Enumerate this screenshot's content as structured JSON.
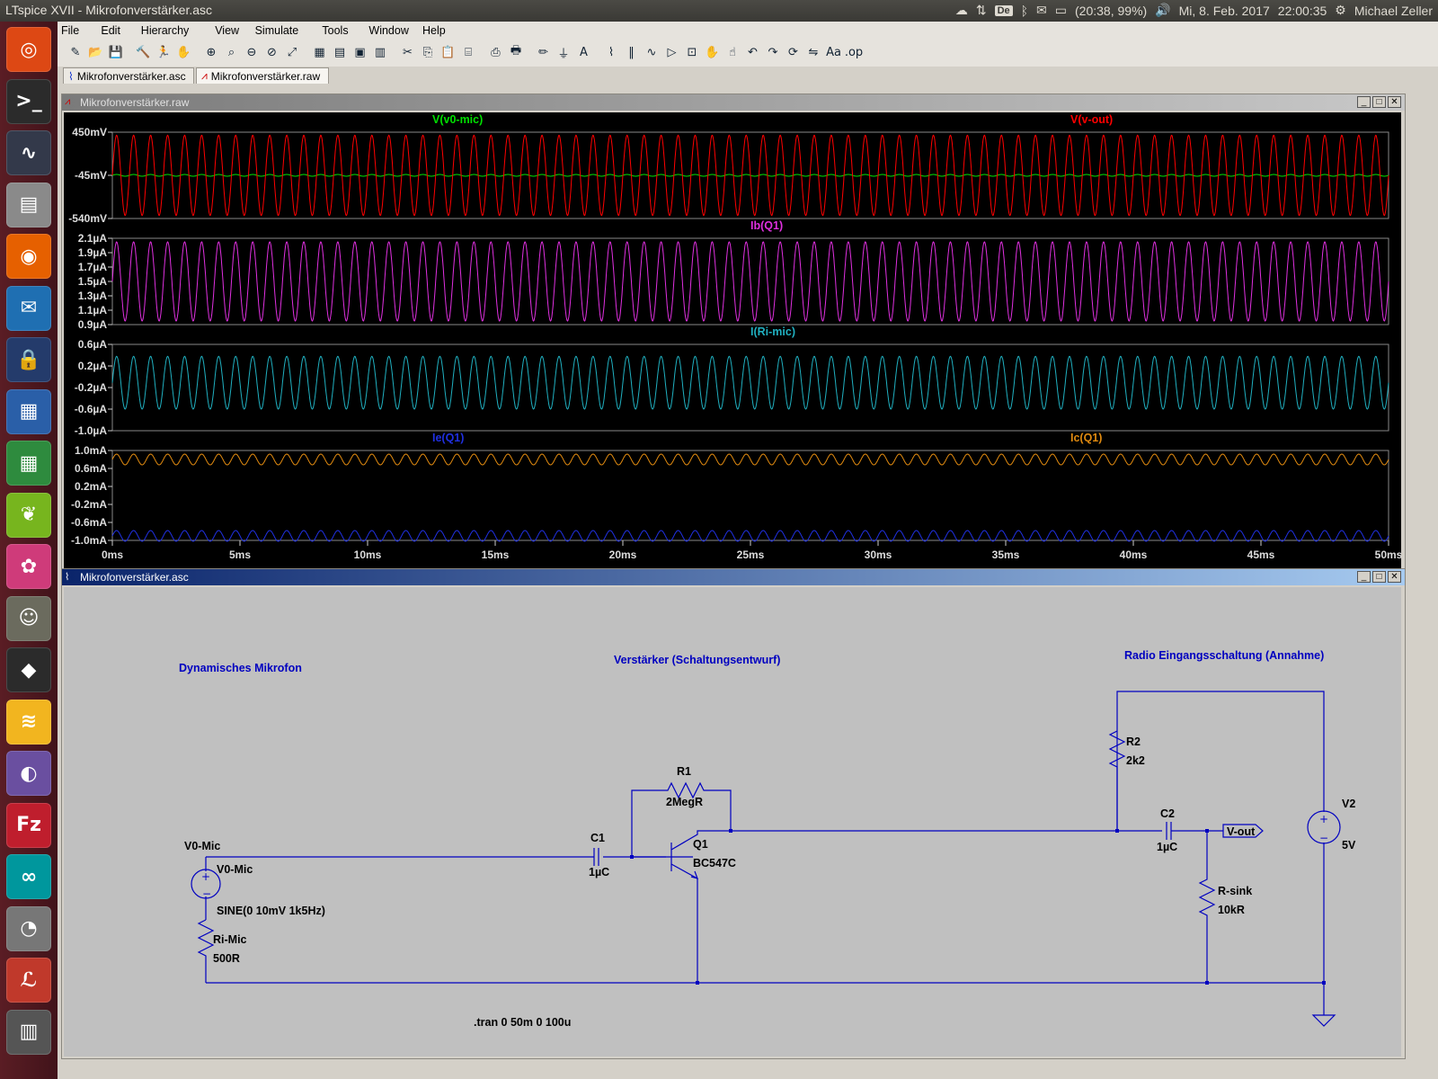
{
  "window_title": "LTspice XVII - Mikrofonverstärker.asc",
  "tray": {
    "keyboard": "De",
    "battery": "(20:38, 99%)",
    "date": "Mi, 8. Feb. 2017",
    "time": "22:00:35",
    "user": "Michael Zeller"
  },
  "launcher": [
    "ubuntu-icon",
    "terminal-icon",
    "system-monitor-icon",
    "file-manager-icon",
    "firefox-icon",
    "thunderbird-icon",
    "keepass-icon",
    "writer-icon",
    "calc-icon",
    "evolution-icon",
    "shotwell-icon",
    "gimp-icon",
    "inkscape-icon",
    "layers-icon",
    "eclipse-icon",
    "filezilla-icon",
    "arduino-icon",
    "disks-icon",
    "lazarus-icon",
    "stack-icon"
  ],
  "menu": [
    "File",
    "Edit",
    "Hierarchy",
    "View",
    "Simulate",
    "Tools",
    "Window",
    "Help"
  ],
  "tabs": [
    {
      "label": "Mikrofonverstärker.asc"
    },
    {
      "label": "Mikrofonverstärker.raw"
    }
  ],
  "plot_window": {
    "title": "Mikrofonverstärker.raw"
  },
  "schematic_window": {
    "title": "Mikrofonverstärker.asc"
  },
  "chart_data": [
    {
      "type": "line",
      "title": "",
      "series": [
        {
          "name": "V(v0-mic)",
          "color": "#00e000",
          "amplitude_mV": 10,
          "offset_mV": -45
        },
        {
          "name": "V(v-out)",
          "color": "#ff0000",
          "amplitude_mV": 460,
          "offset_mV": -45
        }
      ],
      "yticks": [
        "450mV",
        "-45mV",
        "-540mV"
      ],
      "ylim": [
        -540,
        450
      ],
      "frequency_hz": 1500
    },
    {
      "type": "line",
      "series": [
        {
          "name": "Ib(Q1)",
          "color": "#e030e0",
          "amplitude_uA": 0.55,
          "offset_uA": 1.5
        }
      ],
      "yticks": [
        "2.1µA",
        "1.9µA",
        "1.7µA",
        "1.5µA",
        "1.3µA",
        "1.1µA",
        "0.9µA"
      ],
      "ylim": [
        0.9,
        2.1
      ],
      "frequency_hz": 1500
    },
    {
      "type": "line",
      "series": [
        {
          "name": "I(Ri-mic)",
          "color": "#20b0c0",
          "amplitude_uA": 0.55,
          "offset_uA": 0
        }
      ],
      "yticks": [
        "0.6µA",
        "0.2µA",
        "-0.2µA",
        "-0.6µA",
        "-1.0µA"
      ],
      "ylim": [
        -1.0,
        0.8
      ],
      "frequency_hz": 1500
    },
    {
      "type": "line",
      "series": [
        {
          "name": "Ie(Q1)",
          "color": "#2030e0",
          "amplitude_mA": 0.12,
          "offset_mA": -0.9
        },
        {
          "name": "Ic(Q1)",
          "color": "#e08a10",
          "amplitude_mA": 0.12,
          "offset_mA": 0.8
        }
      ],
      "yticks": [
        "1.0mA",
        "0.6mA",
        "0.2mA",
        "-0.2mA",
        "-0.6mA",
        "-1.0mA"
      ],
      "ylim": [
        -1.0,
        1.0
      ],
      "frequency_hz": 1500
    }
  ],
  "xaxis": {
    "ticks": [
      "0ms",
      "5ms",
      "10ms",
      "15ms",
      "20ms",
      "25ms",
      "30ms",
      "35ms",
      "40ms",
      "45ms",
      "50ms"
    ],
    "xlim": [
      0,
      50
    ]
  },
  "schematic": {
    "labels": {
      "mic_section": "Dynamisches Mikrofon",
      "amp_section": "Verstärker (Schaltungsentwurf)",
      "radio_section": "Radio Eingangsschaltung (Annahme)",
      "v0_net": "V0-Mic",
      "v0_source": "V0-Mic",
      "v0_value": "SINE(0 10mV 1k5Hz)",
      "ri_name": "Ri-Mic",
      "ri_value": "500R",
      "c1_name": "C1",
      "c1_value": "1µC",
      "r1_name": "R1",
      "r1_value": "2MegR",
      "q1_name": "Q1",
      "q1_value": "BC547C",
      "r2_name": "R2",
      "r2_value": "2k2",
      "c2_name": "C2",
      "c2_value": "1µC",
      "vout": "V-out",
      "rsink_name": "R-sink",
      "rsink_value": "10kR",
      "v2_name": "V2",
      "v2_value": "5V",
      "directive": ".tran 0 50m 0 100u"
    }
  }
}
